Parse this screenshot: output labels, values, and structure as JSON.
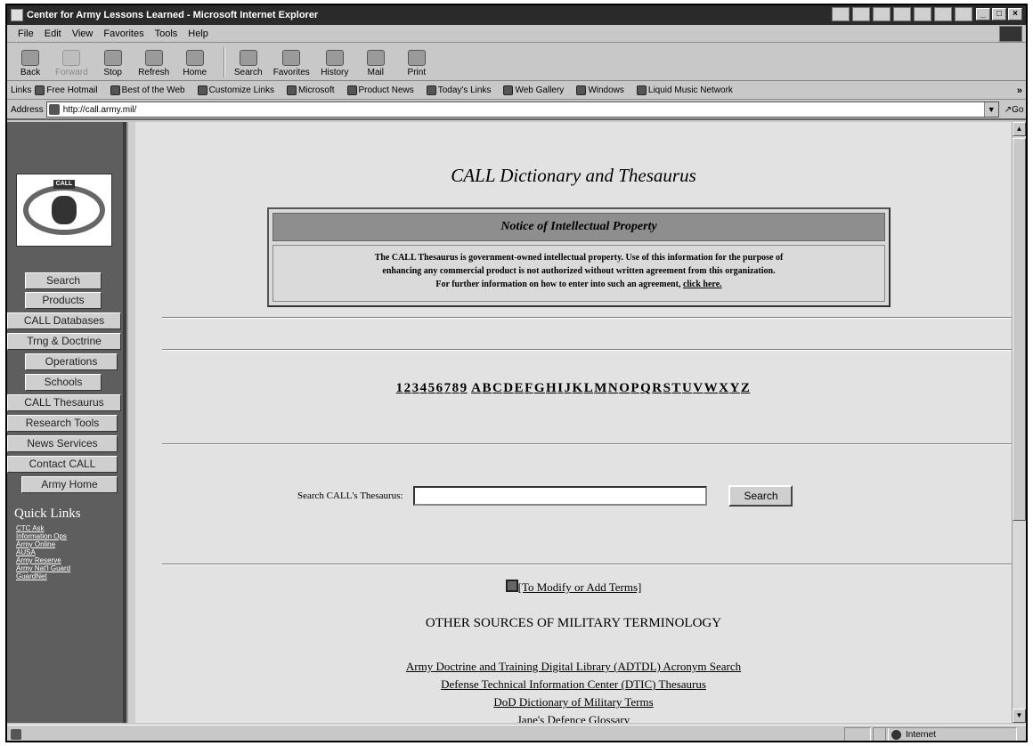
{
  "window": {
    "title": "Center for Army Lessons Learned - Microsoft Internet Explorer",
    "controls": [
      "_",
      "□",
      "×"
    ]
  },
  "menu": [
    "File",
    "Edit",
    "View",
    "Favorites",
    "Tools",
    "Help"
  ],
  "toolbar": {
    "buttons": [
      {
        "label": "Back",
        "icon": "back-arrow-icon",
        "enabled": true
      },
      {
        "label": "Forward",
        "icon": "forward-arrow-icon",
        "enabled": false
      },
      {
        "label": "Stop",
        "icon": "stop-icon",
        "enabled": true
      },
      {
        "label": "Refresh",
        "icon": "refresh-icon",
        "enabled": true
      },
      {
        "label": "Home",
        "icon": "home-icon",
        "enabled": true
      },
      {
        "label": "Search",
        "icon": "search-icon",
        "enabled": true
      },
      {
        "label": "Favorites",
        "icon": "favorites-icon",
        "enabled": true
      },
      {
        "label": "History",
        "icon": "history-icon",
        "enabled": true
      },
      {
        "label": "Mail",
        "icon": "mail-icon",
        "enabled": true
      },
      {
        "label": "Print",
        "icon": "print-icon",
        "enabled": true
      }
    ]
  },
  "links_bar": {
    "label": "Links",
    "items": [
      "Free Hotmail",
      "Best of the Web",
      "Customize Links",
      "Microsoft",
      "Product News",
      "Today's Links",
      "Web Gallery",
      "Windows",
      "Liquid Music Network"
    ],
    "more": "»"
  },
  "address": {
    "label": "Address",
    "url": "http://call.army.mil/",
    "go_label": "Go"
  },
  "sidebar": {
    "logo_text": "CALL",
    "nav": [
      "Search",
      "Products",
      "CALL Databases",
      "Trng & Doctrine",
      "Operations",
      "Schools",
      "CALL Thesaurus",
      "Research Tools",
      "News Services",
      "Contact CALL",
      "Army Home"
    ],
    "quick_links_title": "Quick Links",
    "quick_links": [
      "CTC Ask",
      "Information Ops",
      "Army Online",
      "AUSA",
      "Army Reserve",
      "Army Nat'l Guard",
      "GuardNet"
    ]
  },
  "main": {
    "title": "CALL Dictionary and Thesaurus",
    "notice": {
      "heading": "Notice of Intellectual Property",
      "line1": "The CALL Thesaurus is government-owned intellectual property. Use of this information for the purpose of",
      "line2": "enhancing any commercial product is not authorized without written agreement from this organization.",
      "line3": "For further information on how to enter into such an agreement,",
      "link": "click here."
    },
    "index_chars": [
      "1",
      "2",
      "3",
      "4",
      "5",
      "6",
      "7",
      "8",
      "9",
      "A",
      "B",
      "C",
      "D",
      "E",
      "F",
      "G",
      "H",
      "I",
      "J",
      "K",
      "L",
      "M",
      "N",
      "O",
      "P",
      "Q",
      "R",
      "S",
      "T",
      "U",
      "V",
      "W",
      "X",
      "Y",
      "Z"
    ],
    "search": {
      "label": "Search CALL's Thesaurus:",
      "value": "",
      "button": "Search"
    },
    "modify_link": "[To Modify or Add Terms]",
    "other_heading": "OTHER SOURCES OF MILITARY TERMINOLOGY",
    "sources": [
      "Army Doctrine and Training Digital Library (ADTDL) Acronym Search",
      "Defense Technical Information Center (DTIC) Thesaurus",
      "DoD Dictionary of Military Terms",
      "Jane's Defence Glossary"
    ]
  },
  "status": {
    "zone": "Internet"
  }
}
